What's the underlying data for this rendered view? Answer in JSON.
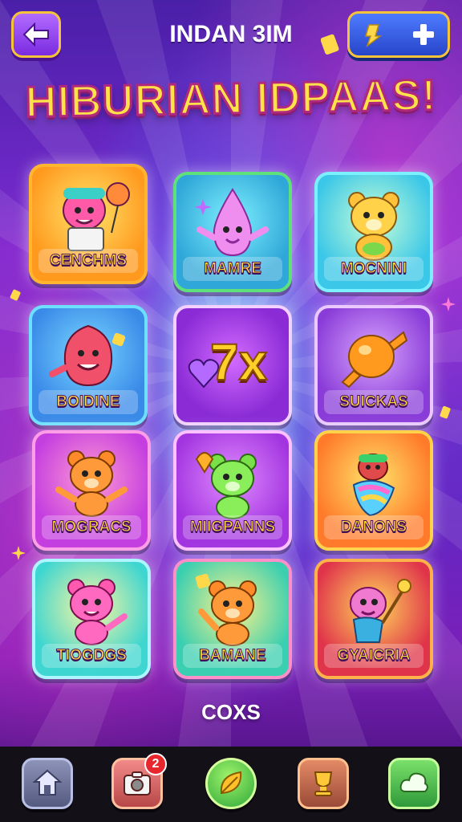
{
  "header": {
    "title": "INDAN 3IM",
    "back_icon": "arrow-left-icon",
    "currency_icon": "token-icon",
    "add_icon": "plus-icon"
  },
  "banner": {
    "text": "HIBURIAN IDPAAS!"
  },
  "tiles": [
    {
      "label": "CENCHMS",
      "icon": "creature-with-box"
    },
    {
      "label": "MAMRE",
      "icon": "pink-drop-creature"
    },
    {
      "label": "MOCNINI",
      "icon": "yellow-bear"
    },
    {
      "label": "BOIDINE",
      "icon": "red-creature"
    },
    {
      "label": "7x",
      "icon": "heart-icon"
    },
    {
      "label": "SUICKAS",
      "icon": "orange-candy"
    },
    {
      "label": "MOGRACS",
      "icon": "orange-bear"
    },
    {
      "label": "MIIGPANNS",
      "icon": "green-bear"
    },
    {
      "label": "DANONS",
      "icon": "colorful-creature"
    },
    {
      "label": "TIOGDGS",
      "icon": "pink-bear"
    },
    {
      "label": "BAMANE",
      "icon": "orange-bear-waving"
    },
    {
      "label": "GYAICRIA",
      "icon": "pink-creature-with-wand"
    }
  ],
  "caption": "COXS",
  "bottom_nav": {
    "items": [
      {
        "icon": "home-icon"
      },
      {
        "icon": "camera-icon",
        "badge": "2"
      },
      {
        "icon": "leaf-icon"
      },
      {
        "icon": "trophy-icon"
      },
      {
        "icon": "cloud-icon"
      }
    ]
  },
  "colors": {
    "accent_gold": "#ffd93a",
    "background_top": "#4a1fa8",
    "background_bottom": "#3b0f6e",
    "nav_bar": "#141018",
    "badge_red": "#e8262e"
  }
}
